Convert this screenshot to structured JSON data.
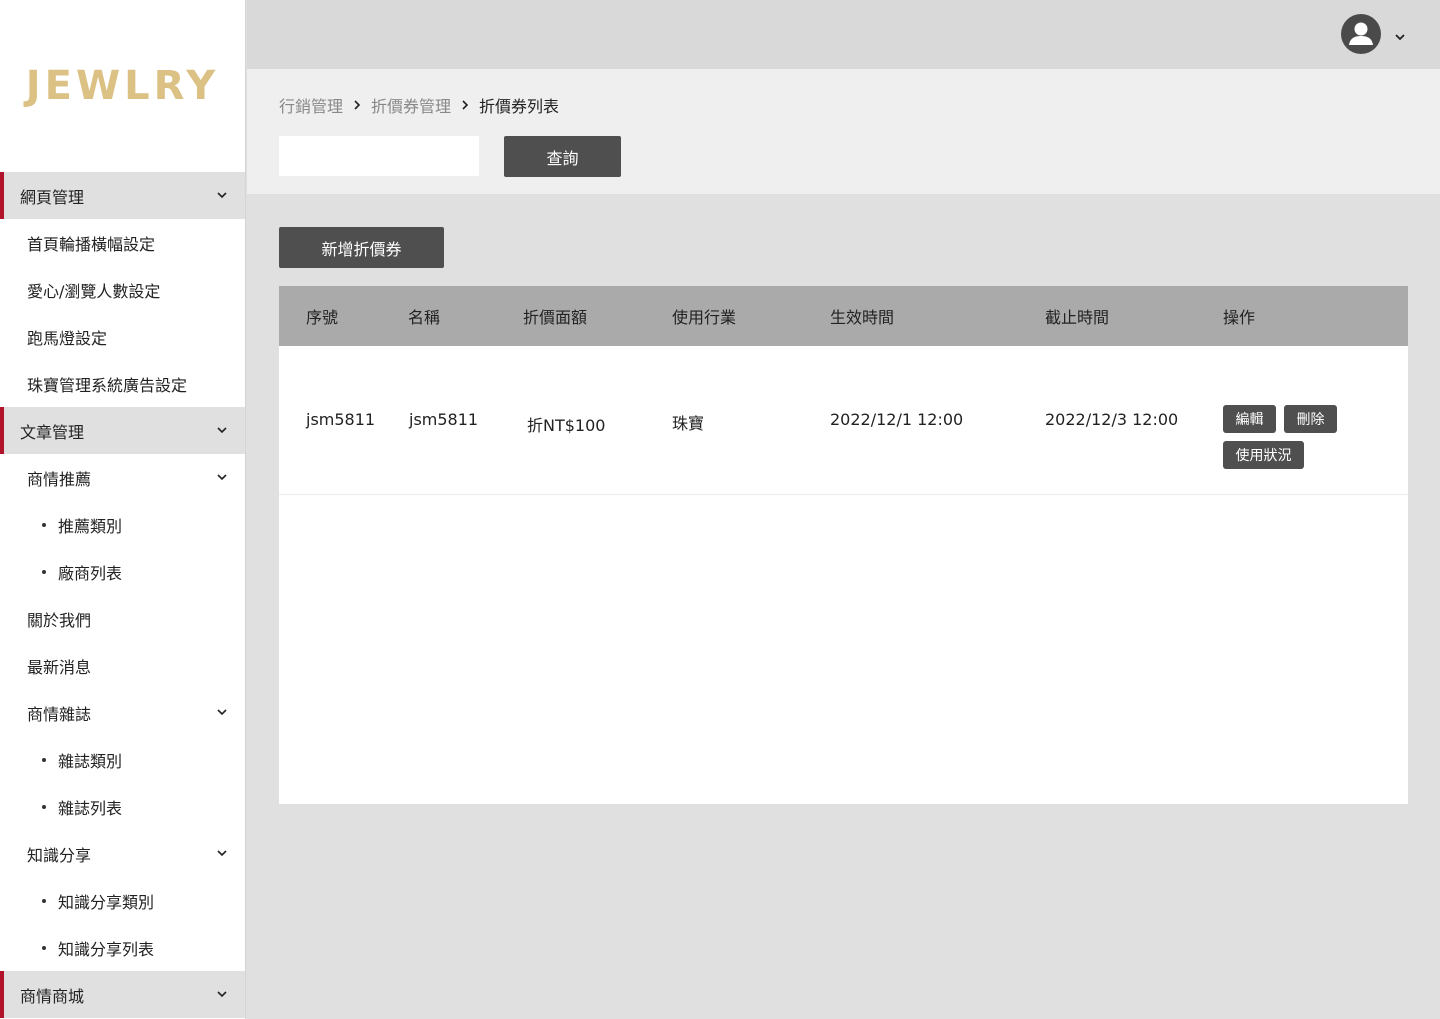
{
  "brand": {
    "logo_text": "JEWLRY",
    "logo_color": "#dcc184"
  },
  "colors": {
    "accent": "#b1132b",
    "button": "#4f4f4f",
    "table_header": "#aaaaaa"
  },
  "sidebar": {
    "web_management": {
      "label": "網頁管理",
      "items": [
        "首頁輪播橫幅設定",
        "愛心/瀏覽人數設定",
        "跑馬燈設定",
        "珠寶管理系統廣告設定"
      ]
    },
    "article_management": {
      "label": "文章管理",
      "business_recommend": {
        "label": "商情推薦",
        "subs": [
          "推薦類別",
          "廠商列表"
        ]
      },
      "about_us": "關於我們",
      "latest_news": "最新消息",
      "business_magazine": {
        "label": "商情雜誌",
        "subs": [
          "雜誌類別",
          "雜誌列表"
        ]
      },
      "knowledge_share": {
        "label": "知識分享",
        "subs": [
          "知識分享類別",
          "知識分享列表"
        ]
      }
    },
    "business_mall": {
      "label": "商情商城"
    }
  },
  "topbar": {
    "avatar_icon": "user-avatar-icon",
    "menu_icon": "chevron-down-icon"
  },
  "breadcrumb": [
    "行銷管理",
    "折價券管理",
    "折價券列表"
  ],
  "filter": {
    "search_value": "",
    "query_label": "查詢"
  },
  "actions": {
    "add_label": "新增折價券"
  },
  "table": {
    "headers": [
      "序號",
      "名稱",
      "折價面額",
      "使用行業",
      "生效時間",
      "截止時間",
      "操作"
    ],
    "rows": [
      {
        "serial": "jsm5811",
        "name": "jsm5811",
        "amount": "折NT$100",
        "industry": "珠寶",
        "start": "2022/12/1 12:00",
        "end": "2022/12/3 12:00",
        "edit": "編輯",
        "delete": "刪除",
        "usage": "使用狀況"
      }
    ]
  }
}
